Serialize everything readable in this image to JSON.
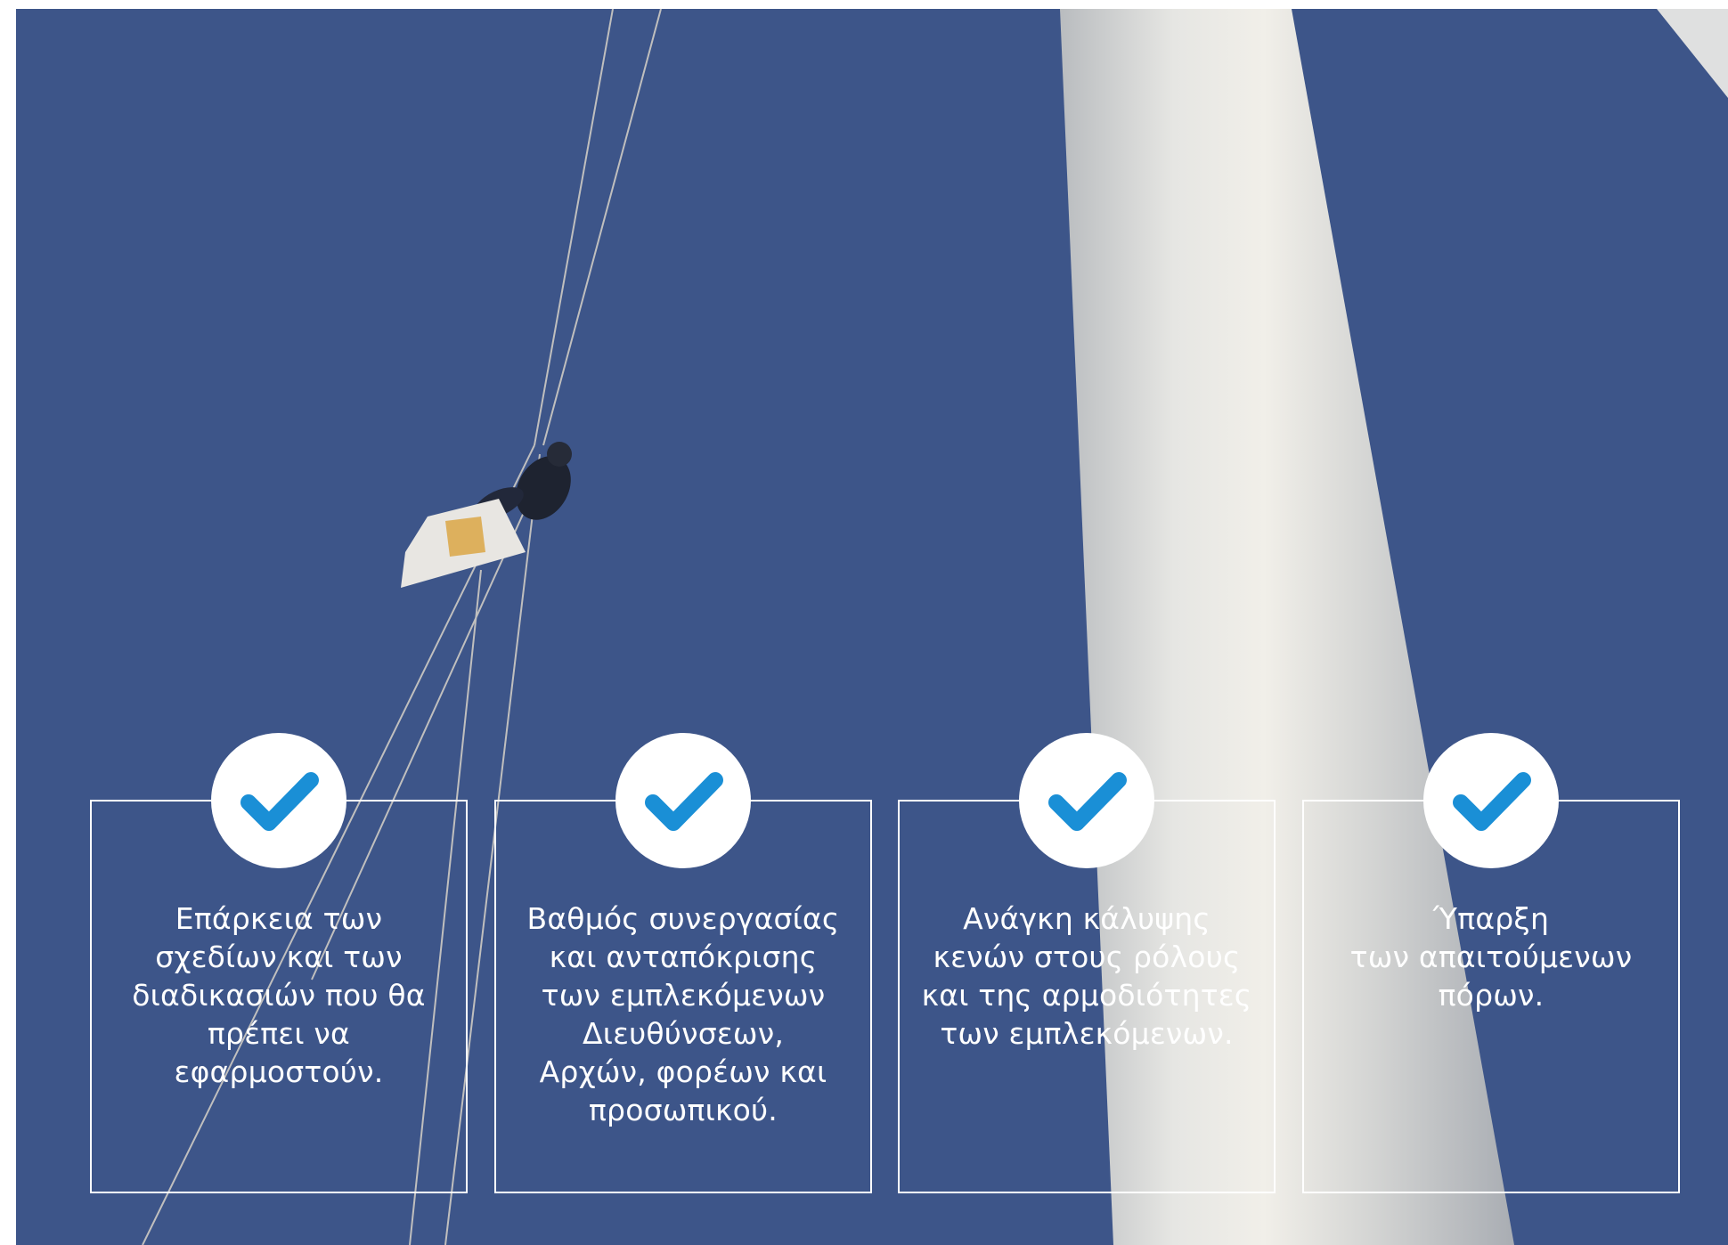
{
  "colors": {
    "sky": "#3c5488",
    "tower": "#dcdcd8",
    "accent": "#1a8fd6",
    "card_border": "#ffffff",
    "card_text": "#ffffff"
  },
  "cards": [
    {
      "icon": "checkmark-icon",
      "text": "Επάρκεια των\nσχεδίων και των\nδιαδικασιών που θα\nπρέπει να\nεφαρμοστούν."
    },
    {
      "icon": "checkmark-icon",
      "text": "Βαθμός συνεργασίας\nκαι ανταπόκρισης\nτων εμπλεκόμενων\nΔιευθύνσεων,\nΑρχών, φορέων και\nπροσωπικού."
    },
    {
      "icon": "checkmark-icon",
      "text": "Ανάγκη κάλυψης\nκενών στους ρόλους\nκαι της αρμοδιότητες\nτων εμπλεκόμενων."
    },
    {
      "icon": "checkmark-icon",
      "text": "Ύπαρξη\nτων απαιτούμενων\nπόρων."
    }
  ]
}
